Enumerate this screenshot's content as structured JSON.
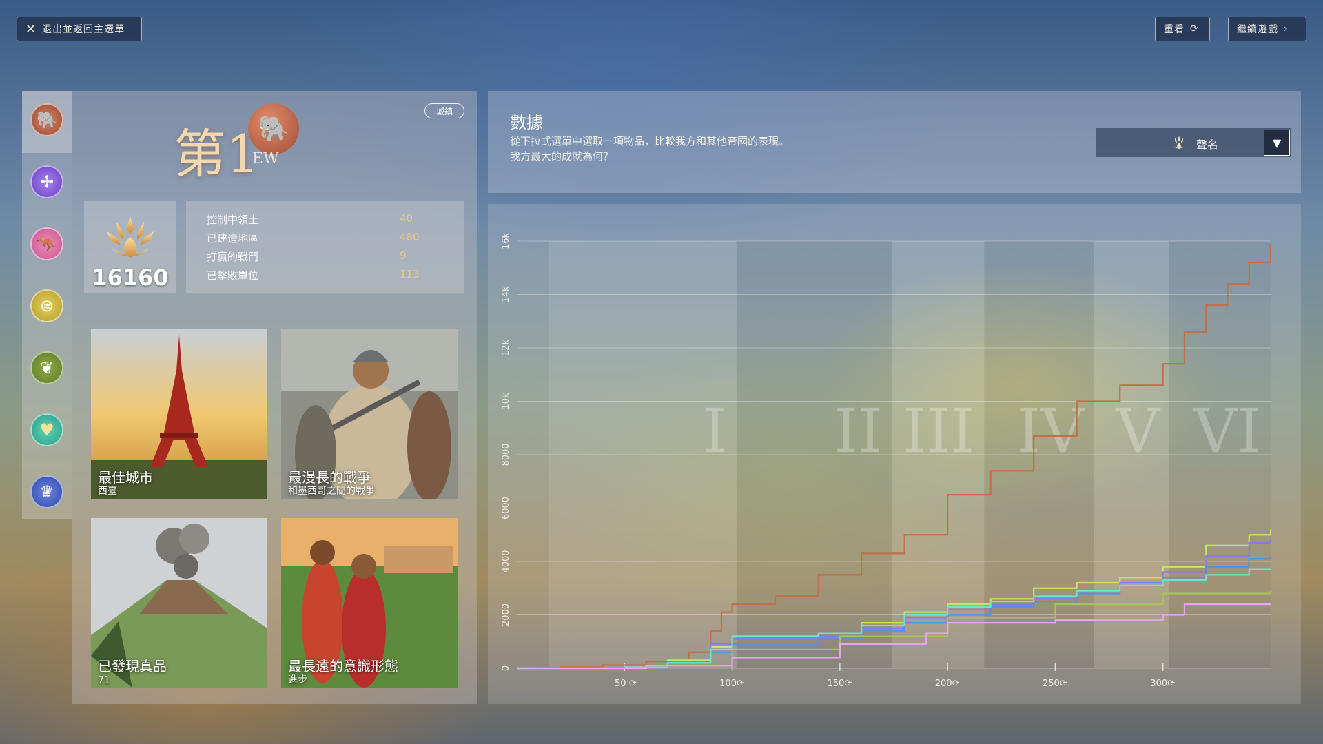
{
  "top_bar": {
    "exit_label": "退出並返回主選單",
    "review_label": "重看",
    "continue_label": "繼續遊戲"
  },
  "sidebar": {
    "items": [
      {
        "icon": "elephant-icon",
        "color": "#b45a3e"
      },
      {
        "icon": "military-icon",
        "color": "#7a4fd0"
      },
      {
        "icon": "kangaroo-icon",
        "color": "#d86aa0"
      },
      {
        "icon": "economic-icon",
        "color": "#c9b23a"
      },
      {
        "icon": "laurel-icon",
        "color": "#6f8a2c"
      },
      {
        "icon": "heart-icon",
        "color": "#35b79a"
      },
      {
        "icon": "crown-icon",
        "color": "#3c58b8"
      }
    ]
  },
  "rank": {
    "text": "第1",
    "suffix": "EW",
    "settlement_tag": "城鎮"
  },
  "score": {
    "value": "16160"
  },
  "stats": [
    {
      "label": "控制中領土",
      "value": "40"
    },
    {
      "label": "已建造地區",
      "value": "480"
    },
    {
      "label": "打贏的戰鬥",
      "value": "9"
    },
    {
      "label": "已擊敗單位",
      "value": "113"
    }
  ],
  "cards": [
    {
      "title": "最佳城市",
      "subtitle": "西臺"
    },
    {
      "title": "最漫長的戰爭",
      "subtitle": "和墨西哥之間的戰爭"
    },
    {
      "title": "已發現真品",
      "subtitle": "71"
    },
    {
      "title": "最長遠的意識形態",
      "subtitle": "進步"
    }
  ],
  "data_panel": {
    "title": "數據",
    "description_line1": "從下拉式選單中選取一項物品，比較我方和其他帝國的表現。",
    "description_line2": "我方最大的成就為何？",
    "dropdown_selected": "聲名"
  },
  "chart_data": {
    "type": "line",
    "x_ticks": [
      50,
      100,
      150,
      200,
      250,
      300
    ],
    "y_ticks": [
      "0",
      "2000",
      "4000",
      "6000",
      "8000",
      "10k",
      "12k",
      "14k",
      "16k"
    ],
    "xlim": [
      0,
      350
    ],
    "ylim": [
      0,
      16000
    ],
    "eras": [
      "I",
      "II",
      "III",
      "IV",
      "V",
      "VI"
    ],
    "era_boundaries": [
      15,
      102,
      174,
      217,
      268,
      303,
      350
    ],
    "series": [
      {
        "color": "#c0704a",
        "x": [
          0,
          10,
          20,
          40,
          60,
          80,
          90,
          95,
          100,
          120,
          140,
          160,
          180,
          200,
          220,
          240,
          260,
          280,
          300,
          310,
          320,
          330,
          340,
          350
        ],
        "y": [
          0,
          20,
          50,
          120,
          250,
          600,
          1400,
          2100,
          2400,
          2700,
          3500,
          4300,
          5000,
          6500,
          7400,
          8700,
          10000,
          10600,
          11400,
          12600,
          13600,
          14400,
          15200,
          15900
        ]
      },
      {
        "color": "#c6e36a",
        "x": [
          0,
          50,
          70,
          90,
          100,
          140,
          160,
          180,
          200,
          220,
          240,
          260,
          280,
          300,
          320,
          340,
          350
        ],
        "y": [
          0,
          50,
          300,
          800,
          1200,
          1300,
          1700,
          2100,
          2400,
          2600,
          3000,
          3200,
          3400,
          3800,
          4600,
          5000,
          5200
        ]
      },
      {
        "color": "#8a7ae6",
        "x": [
          0,
          50,
          70,
          90,
          100,
          140,
          160,
          180,
          200,
          220,
          240,
          260,
          280,
          300,
          320,
          340,
          350
        ],
        "y": [
          0,
          40,
          250,
          900,
          1100,
          1200,
          1500,
          1900,
          2200,
          2400,
          2600,
          2900,
          3200,
          3600,
          4200,
          4700,
          4800
        ]
      },
      {
        "color": "#5b8fe0",
        "x": [
          0,
          50,
          70,
          90,
          100,
          140,
          160,
          180,
          200,
          220,
          240,
          260,
          280,
          300,
          320,
          340,
          350
        ],
        "y": [
          0,
          30,
          200,
          600,
          900,
          1100,
          1400,
          1700,
          2000,
          2300,
          2500,
          2800,
          3100,
          3400,
          3800,
          4100,
          4200
        ]
      },
      {
        "color": "#6fe3c8",
        "x": [
          0,
          50,
          70,
          90,
          100,
          140,
          160,
          180,
          200,
          220,
          240,
          260,
          280,
          300,
          320,
          340,
          350
        ],
        "y": [
          0,
          30,
          200,
          700,
          1200,
          1300,
          1600,
          2000,
          2300,
          2500,
          2700,
          2900,
          3100,
          3300,
          3500,
          3700,
          3700
        ]
      },
      {
        "color": "#a6c25a",
        "x": [
          0,
          60,
          100,
          150,
          200,
          250,
          300,
          350
        ],
        "y": [
          0,
          100,
          700,
          1200,
          1900,
          2400,
          2800,
          2900
        ]
      },
      {
        "color": "#e4a6ee",
        "x": [
          0,
          60,
          100,
          150,
          190,
          200,
          250,
          300,
          310,
          350
        ],
        "y": [
          0,
          100,
          400,
          900,
          1300,
          1700,
          1800,
          2000,
          2400,
          2400
        ]
      }
    ]
  }
}
